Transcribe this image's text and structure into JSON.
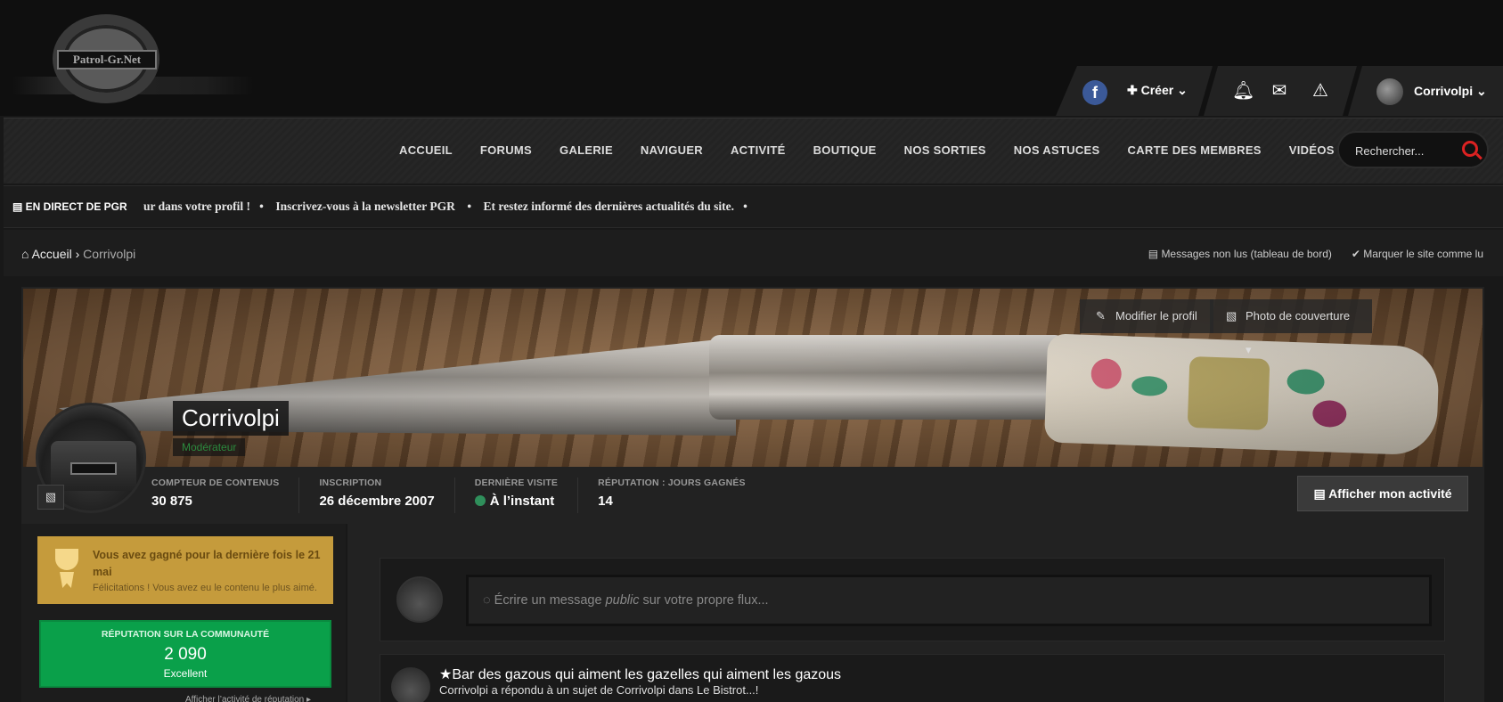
{
  "site": {
    "logo_text": "Patrol-Gr.Net"
  },
  "userbar": {
    "facebook_label": "f",
    "create_label": "Créer",
    "username": "Corrivolpi"
  },
  "nav": {
    "items": [
      "ACCUEIL",
      "FORUMS",
      "GALERIE",
      "NAVIGUER",
      "ACTIVITÉ",
      "BOUTIQUE",
      "NOS SORTIES",
      "NOS ASTUCES",
      "CARTE DES MEMBRES",
      "VIDÉOS"
    ]
  },
  "search": {
    "placeholder": "Rechercher..."
  },
  "ticker": {
    "label": "EN DIRECT DE PGR",
    "text": "ur dans votre profil !   •    Inscrivez-vous à la newsletter PGR    •    Et restez informé des dernières actualités du site.   •"
  },
  "breadcrumb": {
    "home": "Accueil",
    "current": "Corrivolpi",
    "unread": "Messages non lus (tableau de bord)",
    "mark_read": "Marquer le site comme lu"
  },
  "profile": {
    "name": "Corrivolpi",
    "role": "Modérateur",
    "edit_label": "Modifier le profil",
    "cover_label": "Photo de couverture",
    "activity_label": "Afficher mon activité",
    "stats": [
      {
        "key": "COMPTEUR DE CONTENUS",
        "value": "30 875"
      },
      {
        "key": "INSCRIPTION",
        "value": "26 décembre 2007"
      },
      {
        "key": "DERNIÈRE VISITE",
        "value": "À l’instant"
      },
      {
        "key": "RÉPUTATION : JOURS GAGNÉS",
        "value": "14"
      }
    ]
  },
  "sidebar": {
    "award_title": "Vous avez gagné pour la dernière fois le 21 mai",
    "award_sub": "Félicitations ! Vous avez eu le contenu le plus aimé.",
    "rep_key": "RÉPUTATION SUR LA COMMUNAUTÉ",
    "rep_value": "2 090",
    "rep_level": "Excellent",
    "rep_link": "Afficher l’activité de réputation ▸"
  },
  "main": {
    "status_prefix": "Écrire un message ",
    "status_em": "public",
    "status_suffix": " sur votre propre flux...",
    "feed_title": "Bar des gazous qui aiment les gazelles qui aiment les gazous",
    "feed_sub": "Corrivolpi a répondu à un sujet de Corrivolpi dans Le Bistrot...!"
  },
  "colors": {
    "accent_red": "#dd2222",
    "rep_green": "#0aa04a",
    "award_gold": "#c59b3c",
    "online_dot": "#2f8f5b"
  }
}
